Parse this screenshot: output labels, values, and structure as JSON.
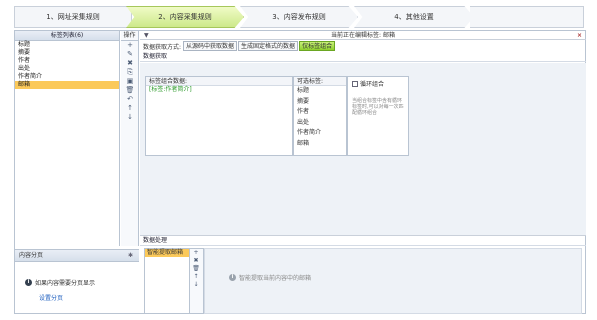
{
  "wizard": {
    "steps": [
      "1、网址采集规则",
      "2、内容采集规则",
      "3、内容发布规则",
      "4、其他设置"
    ],
    "active_step": 2,
    "active_color": "#cde98a"
  },
  "left_panel": {
    "title": "标签列表(6)",
    "tool_header": "操作",
    "tags": [
      "标题",
      "摘要",
      "作者",
      "出处",
      "作者简介",
      "邮箱"
    ],
    "selected_tag": "邮箱"
  },
  "left_bottom": {
    "title": "内容分页",
    "message": "如果内容需要分页显示",
    "link": "设置分页"
  },
  "main": {
    "status": "当前正在编辑标签: 邮箱",
    "source_label": "数据获取方式:",
    "modes": [
      "从源码中获取数据",
      "生成固定格式的数据",
      "仅标签组合"
    ],
    "active_mode": "仅标签组合",
    "extract_title": "数据获取",
    "combo_header": "标签组合数据:",
    "combo_value": "[标签:作者简介]",
    "avail_header": "可选标签:",
    "avail_tags": [
      "标题",
      "摘要",
      "作者",
      "出处",
      "作者简介",
      "邮箱"
    ],
    "loop_label": "循环组合",
    "loop_desc": "当组合标签中含有循环标签时,可以对每一次匹配循环组合",
    "process_title": "数据处理",
    "process_item": "智能提取邮箱",
    "process_msg": "智能提取当前内容中的邮箱"
  }
}
